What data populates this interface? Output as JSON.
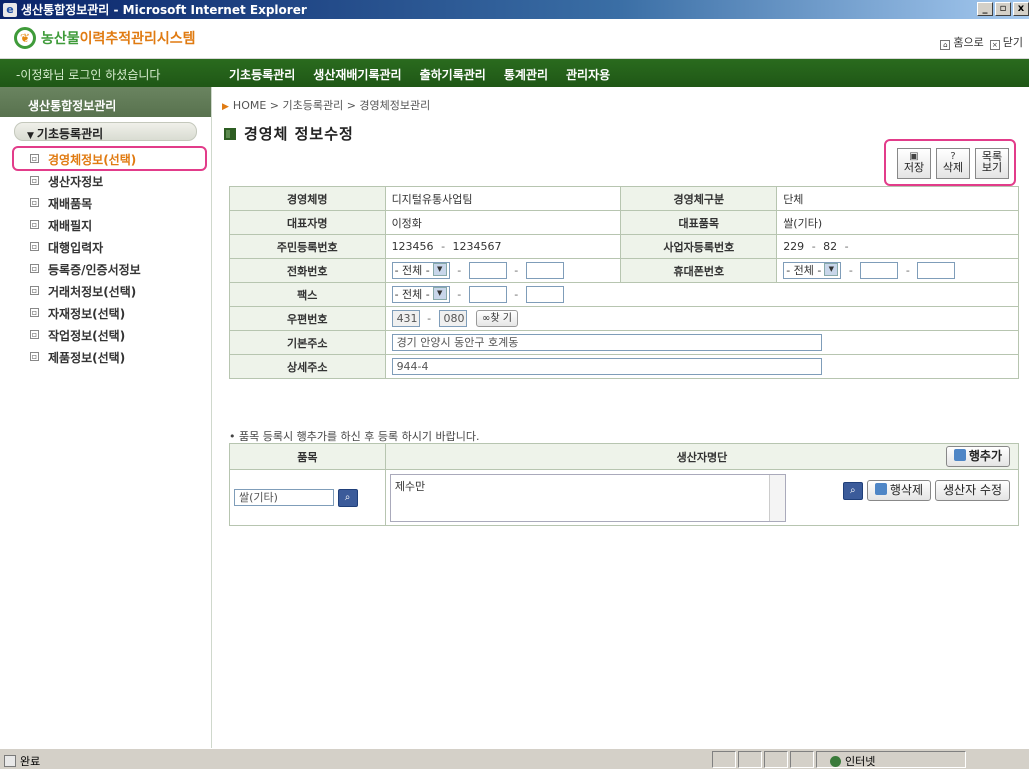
{
  "window": {
    "title": "생산통합정보관리 - Microsoft Internet Explorer",
    "min": "_",
    "max": "▫",
    "close": "x"
  },
  "header": {
    "logo_green": "농산물",
    "logo_orange": "이력추적관리시스템",
    "home_link": "홈으로",
    "close_link": "닫기"
  },
  "navbar": {
    "welcome": "-이정화님 로그인 하셨습니다",
    "menu": [
      "기초등록관리",
      "생산재배기록관리",
      "출하기록관리",
      "통계관리",
      "관리자용"
    ]
  },
  "sidebar": {
    "title": "생산통합정보관리",
    "group": "기초등록관리",
    "items": [
      {
        "label": "경영체정보(선택)"
      },
      {
        "label": "생산자정보"
      },
      {
        "label": "재배품목"
      },
      {
        "label": "재배필지"
      },
      {
        "label": "대행입력자"
      },
      {
        "label": "등록증/인증서정보"
      },
      {
        "label": "거래처정보(선택)"
      },
      {
        "label": "자재정보(선택)"
      },
      {
        "label": "작업정보(선택)"
      },
      {
        "label": "제품정보(선택)"
      }
    ]
  },
  "main": {
    "breadcrumb": "HOME > 기초등록관리 > 경영체정보관리",
    "title": "경영체 정보수정",
    "actions": {
      "save_l1": "저장",
      "save_l0": "▣",
      "delete_l1": "삭제",
      "delete_l0": "?",
      "list_l0": "목록",
      "list_l1": "보기"
    },
    "form": {
      "l_name": "경영체명",
      "v_name": "디지털유통사업팀",
      "l_type": "경영체구분",
      "v_type": "단체",
      "l_rep": "대표자명",
      "v_rep": "이정화",
      "l_item": "대표품목",
      "v_item": "쌀(기타)",
      "l_rrn": "주민등록번호",
      "v_rrn1": "123456",
      "v_rrn_dash": "-",
      "v_rrn2": "1234567",
      "l_biz": "사업자등록번호",
      "v_biz1": "229",
      "v_biz2": "82",
      "v_biz_dash": "-",
      "l_tel": "전화번호",
      "v_tel_sel": "- 전체 -",
      "l_mobile": "휴대폰번호",
      "v_mobile_sel": "- 전체 -",
      "l_fax": "팩스",
      "v_fax_sel": "- 전체 -",
      "l_zip": "우편번호",
      "v_zip1": "431",
      "v_zip2": "080",
      "zip_btn": "찾 기",
      "l_addr": "기본주소",
      "v_addr": "경기 안양시 동안구 호계동",
      "l_addr2": "상세주소",
      "v_addr2": "944-4"
    },
    "note": "• 품목 등록시 행추가를 하신 후 등록 하시기 바랍니다.",
    "items_table": {
      "h_item": "품목",
      "h_producers": "생산자명단",
      "add_row": "행추가",
      "row_item": "쌀(기타)",
      "row_producers": "제수만",
      "del_row": "행삭제",
      "edit_producer": "생산자 수정"
    }
  },
  "statusbar": {
    "status": "완료",
    "zone": "인터넷"
  }
}
